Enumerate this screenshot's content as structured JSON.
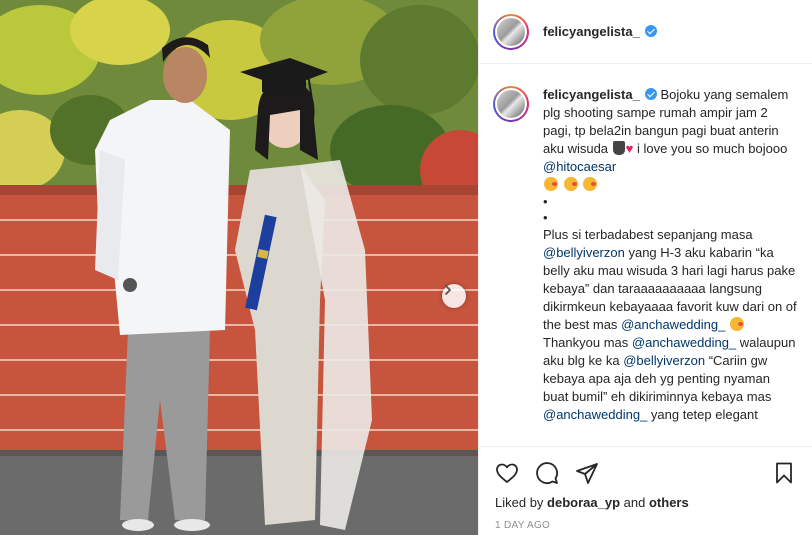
{
  "header": {
    "username": "felicyangelista_"
  },
  "caption": {
    "username": "felicyangelista_",
    "text_1": "Bojoku yang semalem plg shooting sampe rumah ampir jam 2 pagi, tp bela2in bangun pagi buat anterin aku wisuda",
    "text_2": "i love you so much bojooo",
    "mention_1": "@hitocaesar",
    "dot": "•",
    "text_3": "Plus si terbadabest sepanjang masa",
    "mention_2": "@bellyiverzon",
    "text_4": "yang H-3 aku kabarin “ka belly aku mau wisuda 3 hari lagi harus pake kebaya” dan taraaaaaaaaaa langsung dikirmkeun kebayaaaa favorit kuw dari on of the best mas",
    "mention_3": "@anchawedding_",
    "text_5": "Thankyou mas",
    "mention_4": "@anchawedding_",
    "text_6": "walaupun aku blg ke ka",
    "mention_5": "@bellyiverzon",
    "text_7": "“Cariin gw kebaya apa aja deh yg penting nyaman buat bumil” eh dikiriminnya kebaya mas",
    "mention_6": "@anchawedding_",
    "text_8": "yang tetep elegant"
  },
  "likes": {
    "prefix": "Liked by",
    "user": "deboraa_yp",
    "and": "and",
    "others": "others"
  },
  "timestamp": "1 DAY AGO",
  "icons": [
    "heart-icon",
    "comment-icon",
    "share-icon",
    "bookmark-icon",
    "chevron-right-icon",
    "verified-badge-icon"
  ],
  "colors": {
    "verified": "#3897f0",
    "mention": "#00376b",
    "text": "#262626",
    "muted": "#8e8e8e"
  }
}
